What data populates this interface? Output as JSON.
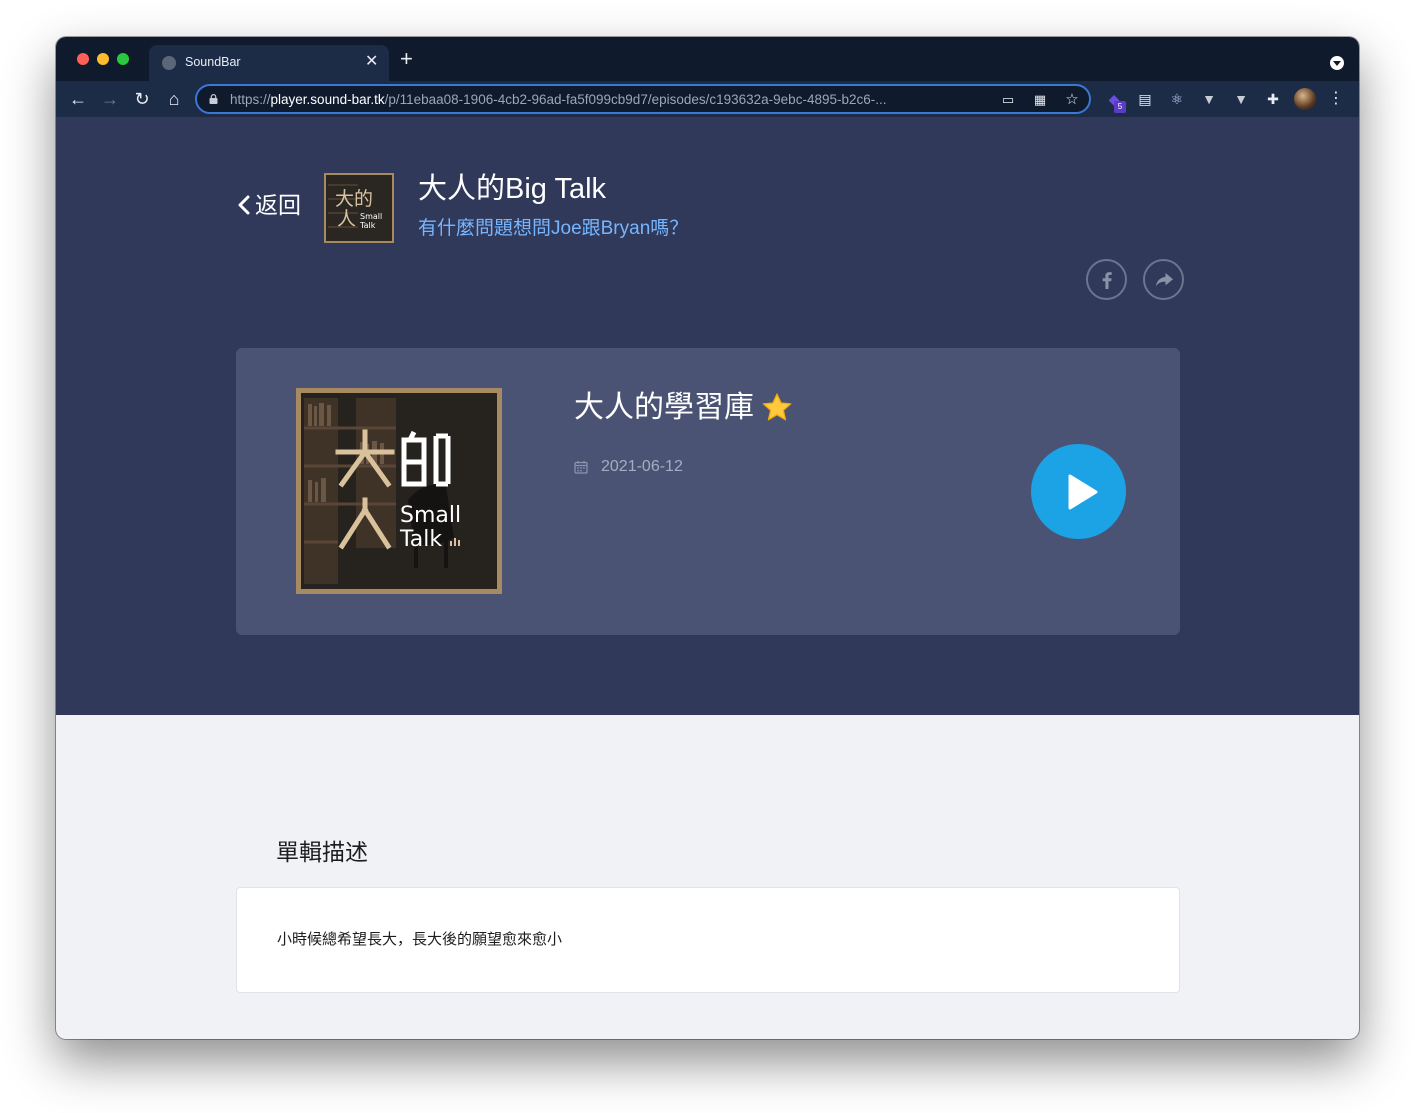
{
  "browser": {
    "tab_title": "SoundBar",
    "tab_close": "✕",
    "new_tab": "+",
    "url_scheme": "https://",
    "url_host": "player.sound-bar.tk",
    "url_path": "/p/11ebaa08-1906-4cb2-96ad-fa5f099cb9d7/episodes/c193632a-9ebc-4895-b2c6-...",
    "extension_badge": "5",
    "icons": [
      "back-icon",
      "forward-icon",
      "reload-icon",
      "home-icon",
      "lock-icon",
      "install-icon",
      "qr-icon",
      "star-icon",
      "extension-icons",
      "puzzle-icon",
      "more-icon"
    ]
  },
  "header": {
    "back_label": "返回",
    "podcast_title": "大人的Big Talk",
    "podcast_subtitle": "有什麼問題想問Joe跟Bryan嗎？",
    "cover_text_top": "大的",
    "cover_text_mid": "人",
    "cover_text_small": "Small",
    "cover_text_talk": "Talk"
  },
  "episode": {
    "title": "大人的學習庫",
    "date": "2021-06-12",
    "cover_text_small": "Small",
    "cover_text_talk": "Talk"
  },
  "description": {
    "section_title": "單輯描述",
    "text": "小時候總希望長大，長大後的願望愈來愈小"
  },
  "colors": {
    "hero_bg": "#30395a",
    "card_bg": "#4a5373",
    "accent_blue": "#1ba3e6",
    "subtitle_blue": "#77b5ff",
    "page_bg": "#f0f2f6"
  }
}
